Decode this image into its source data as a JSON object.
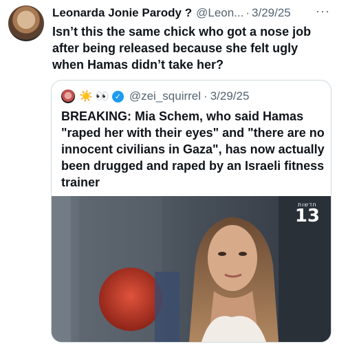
{
  "tweet": {
    "author_name": "Leonarda Jonie Parody ?",
    "handle": "@Leon...",
    "separator": "·",
    "date": "3/29/25",
    "more_icon": "more-icon",
    "text": "Isn’t this the same chick who got a nose job after being released because she felt ugly when Hamas didn’t take her?"
  },
  "quote": {
    "emojis": [
      "☀️",
      "👀"
    ],
    "handle": "@zei_squirrel",
    "separator": "·",
    "date": "3/29/25",
    "text": "BREAKING: Mia Schem, who said Hamas \"raped her with their eyes\" and \"there are no innocent civilians in Gaza\", has now actually been drugged and raped by an Israeli fitness trainer",
    "media": {
      "watermark_small": "חדשות",
      "watermark_big": "13"
    }
  },
  "colors": {
    "text": "#0f1419",
    "muted": "#536471",
    "border": "#cfd9de",
    "verified": "#1d9bf0"
  }
}
